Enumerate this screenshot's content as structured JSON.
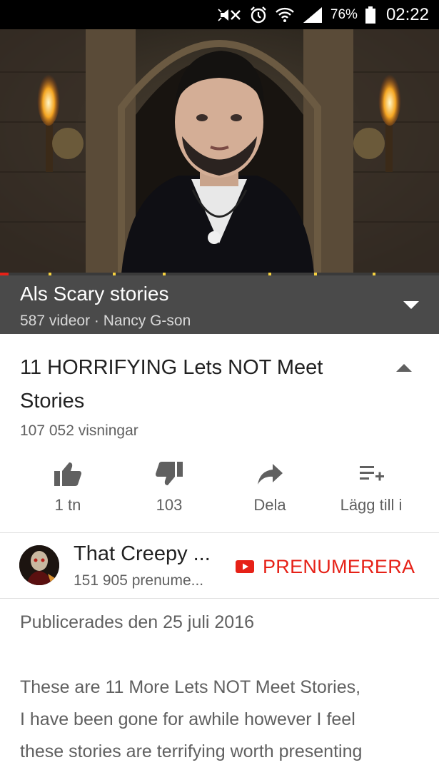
{
  "status_bar": {
    "battery_percent": "76%",
    "time": "02:22",
    "icons": [
      "mute-icon",
      "alarm-icon",
      "wifi-icon",
      "signal-icon",
      "battery-icon"
    ]
  },
  "player": {
    "progress_fraction": 0.02
  },
  "playlist": {
    "title": "Als Scary stories",
    "meta": "587 videor · Nancy G-son"
  },
  "video": {
    "title_line1": "11 HORRIFYING Lets NOT Meet",
    "title_line2": "Stories",
    "views": "107 052 visningar"
  },
  "actions": {
    "like_label": "1 tn",
    "dislike_label": "103",
    "share_label": "Dela",
    "add_label": "Lägg till i"
  },
  "channel": {
    "name": "That Creepy ...",
    "subscribers": "151 905 prenume...",
    "subscribe_label": "PRENUMERERA"
  },
  "description": {
    "published": "Publicerades den 25 juli 2016",
    "text_lines": [
      "These are 11 More Lets NOT Meet Stories,",
      "I have been gone for awhile however I feel",
      "these stories are terrifying worth presenting"
    ]
  },
  "colors": {
    "accent_red": "#e62117",
    "playlist_bg": "#4a4a4a",
    "text_secondary": "#606060"
  }
}
